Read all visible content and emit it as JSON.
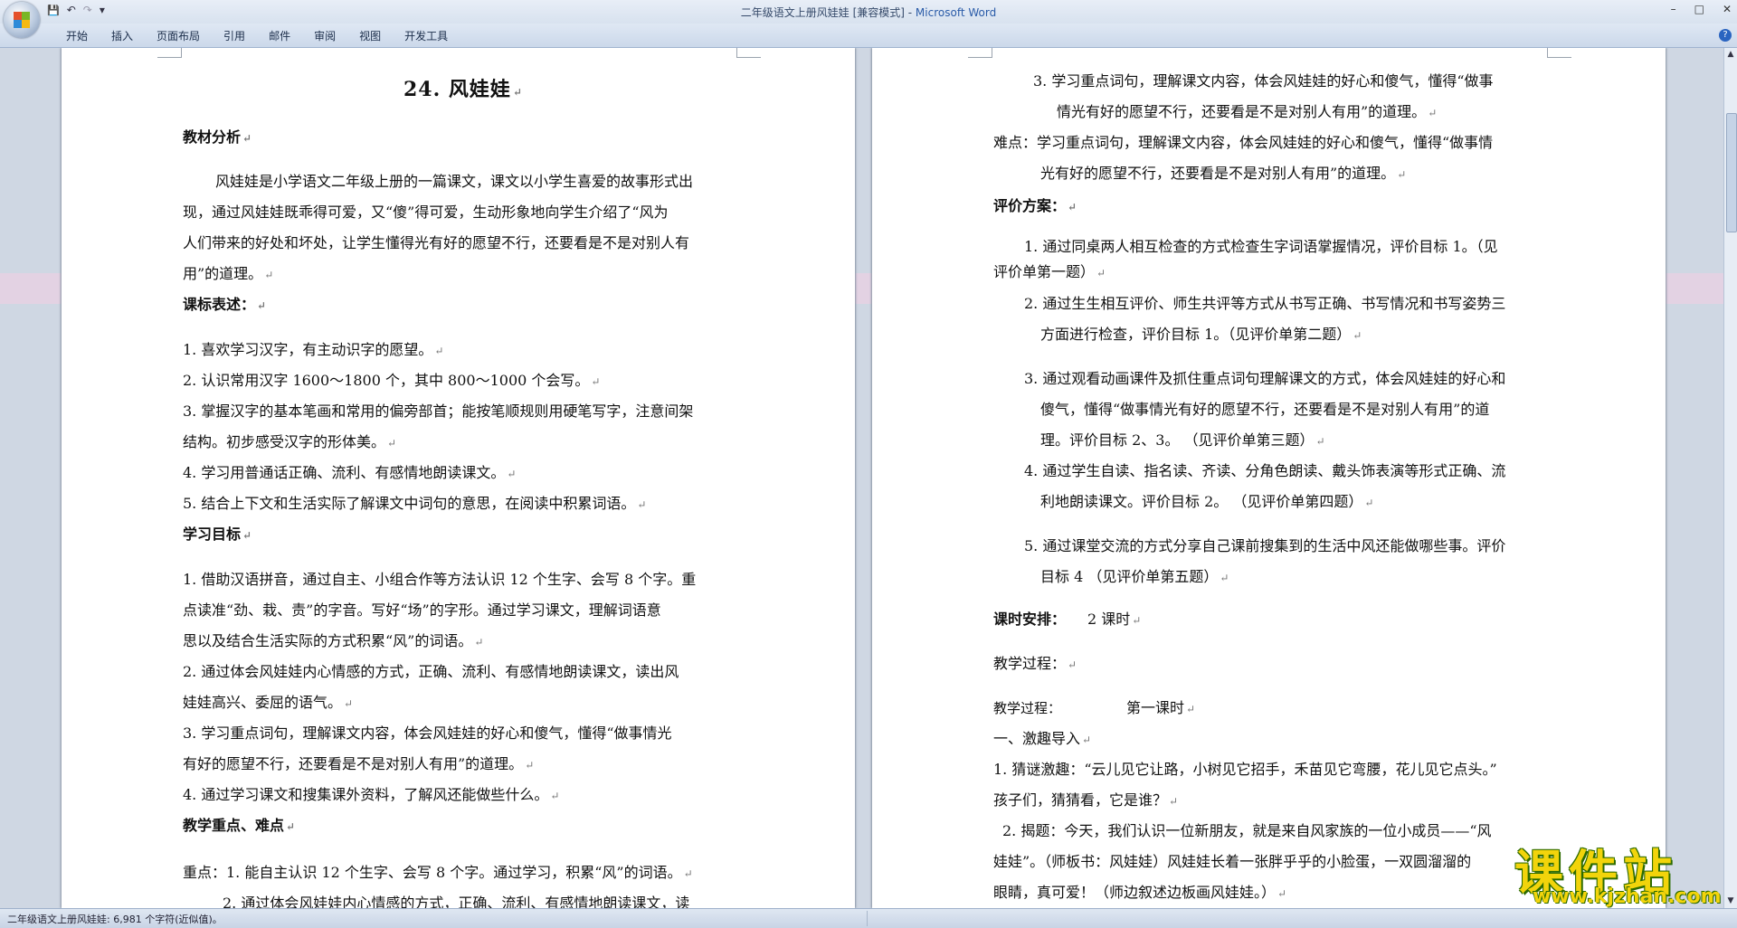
{
  "window": {
    "title": "二年级语文上册风娃娃 [兼容模式] - ",
    "app_name": "Microsoft Word",
    "controls": [
      "–",
      "□",
      "✕"
    ]
  },
  "quick_access": {
    "save": "💾",
    "undo": "↶",
    "redo": "↷",
    "customize": "▾"
  },
  "ribbon": {
    "tabs": [
      "开始",
      "插入",
      "页面布局",
      "引用",
      "邮件",
      "审阅",
      "视图",
      "开发工具"
    ],
    "help": "?"
  },
  "page1": {
    "title": "24. 风娃娃",
    "lines": [
      "教材分析",
      "风娃娃是小学语文二年级上册的一篇课文，课文以小学生喜爱的故事形式出",
      "现，通过风娃娃既乖得可爱，又“傻”得可爱，生动形象地向学生介绍了“风为",
      "人们带来的好处和坏处，让学生懂得光有好的愿望不行，还要看是不是对别人有",
      "用”的道理。",
      "课标表述：",
      "1. 喜欢学习汉字，有主动识字的愿望。",
      "2. 认识常用汉字 1600～1800 个，其中 800～1000 个会写。",
      "3. 掌握汉字的基本笔画和常用的偏旁部首；能按笔顺规则用硬笔写字，注意间架",
      "结构。初步感受汉字的形体美。",
      "4. 学习用普通话正确、流利、有感情地朗读课文。",
      "5.  结合上下文和生活实际了解课文中词句的意思，在阅读中积累词语。",
      "学习目标",
      "1.  借助汉语拼音，通过自主、小组合作等方法认识 12 个生字、会写 8 个字。重",
      "点读准“劲、栽、责”的字音。写好“场”的字形。通过学习课文，理解词语意",
      "思以及结合生活实际的方式积累“风”的词语。",
      "2.  通过体会风娃娃内心情感的方式，正确、流利、有感情地朗读课文，读出风",
      "娃娃高兴、委屈的语气。",
      "3.  学习重点词句，理解课文内容，体会风娃娃的好心和傻气，懂得“做事情光",
      "有好的愿望不行，还要看是不是对别人有用”的道理。",
      "4.  通过学习课文和搜集课外资料，了解风还能做些什么。",
      "教学重点、难点",
      "重点：1.  能自主认识 12 个生字、会写 8 个字。通过学习，积累“风”的词语。",
      "2.  通过体会风娃娃内心情感的方式，正确、流利、有感情地朗读课文，读"
    ]
  },
  "page2": {
    "lines": [
      "3.  学习重点词句，理解课文内容，体会风娃娃的好心和傻气，懂得“做事",
      "情光有好的愿望不行，还要看是不是对别人有用”的道理。",
      "难点：学习重点词句，理解课文内容，体会风娃娃的好心和傻气，懂得“做事情",
      "光有好的愿望不行，还要看是不是对别人有用”的道理。",
      "评价方案：",
      "1. 通过同桌两人相互检查的方式检查生字词语掌握情况，评价目标  1。（见",
      "评价单第一题）",
      "2. 通过生生相互评价、师生共评等方式从书写正确、书写情况和书写姿势三",
      "方面进行检查，评价目标 1。（见评价单第二题）",
      "3. 通过观看动画课件及抓住重点词句理解课文的方式，体会风娃娃的好心和",
      "傻气，懂得“做事情光有好的愿望不行，还要看是不是对别人有用”的道",
      "理。评价目标 2、3。 （见评价单第三题）",
      "4. 通过学生自读、指名读、齐读、分角色朗读、戴头饰表演等形式正确、流",
      "利地朗读课文。评价目标 2。 （见评价单第四题）",
      "5. 通过课堂交流的方式分享自己课前搜集到的生活中风还能做哪些事。评价",
      "目标 4  （见评价单第五题）",
      "课时安排：",
      "2 课时",
      "教学过程：",
      "教学过程：",
      "第一课时",
      "一、激趣导入",
      "1. 猜谜激趣：“云儿见它让路，小树见它招手，禾苗见它弯腰，花儿见它点头。”",
      "孩子们，猜猜看，它是谁？",
      "2. 揭题：今天，我们认识一位新朋友，就是来自风家族的一位小成员——“风",
      "娃娃”。（师板书：风娃娃）风娃娃长着一张胖乎乎的小脸蛋，一双圆溜溜的",
      "眼睛，真可爱！（师边叙述边板画风娃娃。）"
    ]
  },
  "paragraph_mark": "↵",
  "status": {
    "text": "二年级语文上册风娃娃: 6,981 个字符(近似值)。"
  },
  "watermark": {
    "text": "课件站",
    "url": "www.kjzhan.com"
  },
  "colors": {
    "ribbon": "#dfe8f4",
    "workspace": "#cfd7e3",
    "band": "#e3d2e3",
    "watermark": "#f2d40b"
  }
}
